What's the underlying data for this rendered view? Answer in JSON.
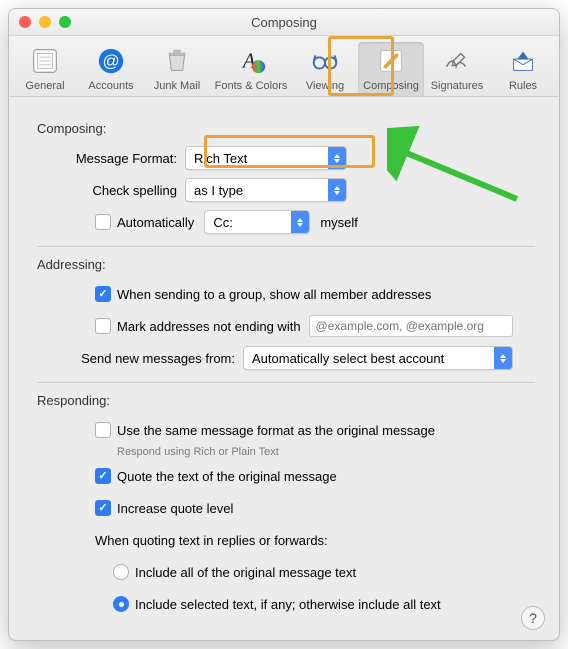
{
  "window": {
    "title": "Composing"
  },
  "toolbar": {
    "items": [
      {
        "label": "General"
      },
      {
        "label": "Accounts"
      },
      {
        "label": "Junk Mail"
      },
      {
        "label": "Fonts & Colors"
      },
      {
        "label": "Viewing"
      },
      {
        "label": "Composing"
      },
      {
        "label": "Signatures"
      },
      {
        "label": "Rules"
      }
    ],
    "selected": "Composing"
  },
  "sections": {
    "composing": {
      "title": "Composing:",
      "message_format": {
        "label": "Message Format:",
        "value": "Rich Text"
      },
      "check_spelling": {
        "label": "Check spelling",
        "value": "as I type"
      },
      "auto_cc": {
        "checkbox_label": "Automatically",
        "field_value": "Cc:",
        "suffix": "myself",
        "checked": false
      }
    },
    "addressing": {
      "title": "Addressing:",
      "group_addresses": {
        "label": "When sending to a group, show all member addresses",
        "checked": true
      },
      "mark_addresses": {
        "label": "Mark addresses not ending with",
        "checked": false,
        "placeholder": "@example.com, @example.org"
      },
      "send_from": {
        "label": "Send new messages from:",
        "value": "Automatically select best account"
      }
    },
    "responding": {
      "title": "Responding:",
      "same_format": {
        "label": "Use the same message format as the original message",
        "checked": false,
        "hint": "Respond using Rich or Plain Text"
      },
      "quote_text": {
        "label": "Quote the text of the original message",
        "checked": true
      },
      "increase_quote": {
        "label": "Increase quote level",
        "checked": true
      },
      "quoting_heading": "When quoting text in replies or forwards:",
      "include_all": {
        "label": "Include all of the original message text",
        "selected": false
      },
      "include_selected": {
        "label": "Include selected text, if any; otherwise include all text",
        "selected": true
      }
    }
  },
  "help_tooltip": "?",
  "colors": {
    "highlight": "#e7a539",
    "arrow": "#3ac03a"
  }
}
